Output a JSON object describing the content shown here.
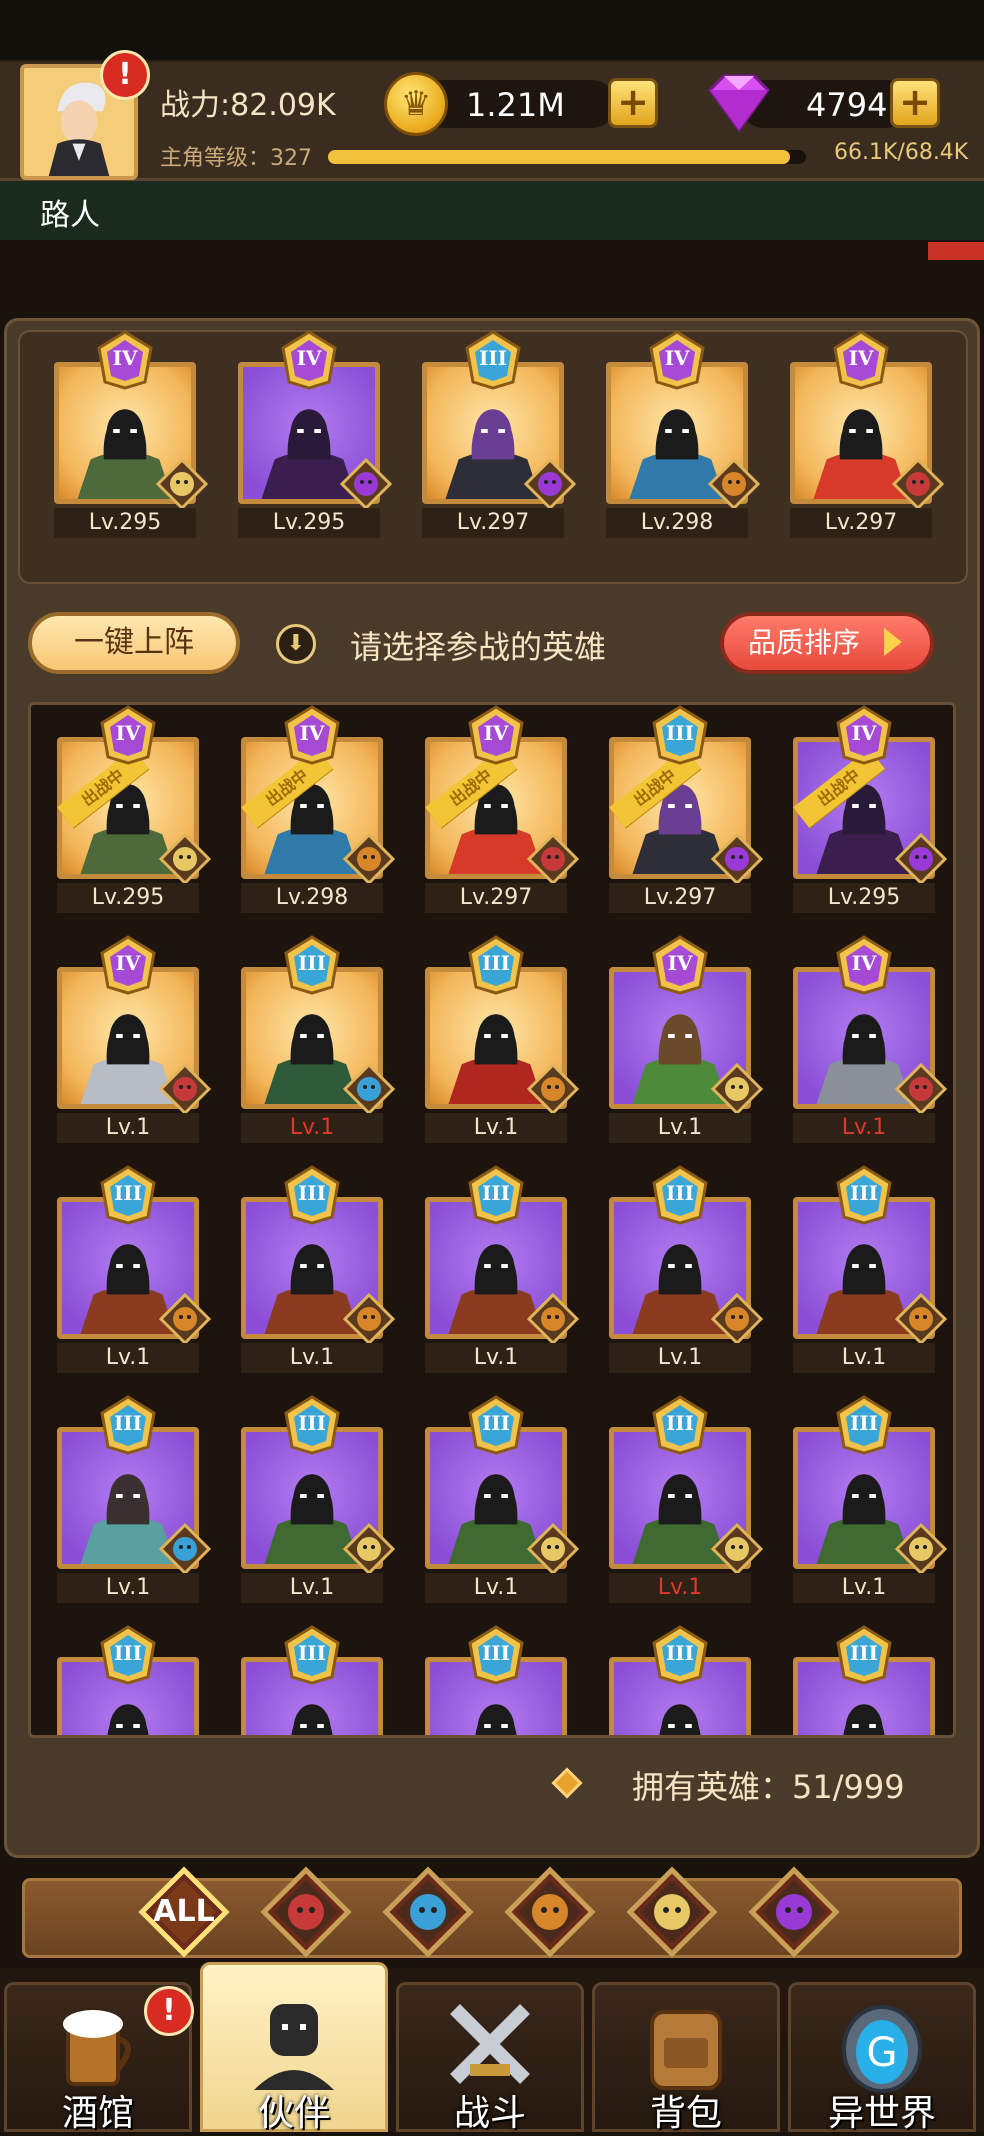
{
  "player": {
    "name": "路人",
    "power": "战力:82.09K",
    "level_label": "主角等级：327",
    "exp": "66.1K/68.4K",
    "exp_fraction": 0.966,
    "alert": "!"
  },
  "resources": {
    "gold": "1.21M",
    "gems": "4794",
    "plus": "+"
  },
  "lineup": [
    {
      "rank": "IV",
      "level": "Lv.295",
      "bg": "gold",
      "faction": "elf",
      "skin": "#1b1b1b",
      "outfit": "#4d6a3a"
    },
    {
      "rank": "IV",
      "level": "Lv.295",
      "bg": "purple",
      "faction": "demon",
      "skin": "#2a1a3a",
      "outfit": "#3a1e4e"
    },
    {
      "rank": "III",
      "level": "Lv.297",
      "bg": "gold",
      "faction": "demon",
      "skin": "#6a3f93",
      "outfit": "#2e2e38"
    },
    {
      "rank": "IV",
      "level": "Lv.298",
      "bg": "gold",
      "faction": "beast",
      "skin": "#1b1b1b",
      "outfit": "#2f7aa8"
    },
    {
      "rank": "IV",
      "level": "Lv.297",
      "bg": "gold",
      "faction": "human",
      "skin": "#1b1b1b",
      "outfit": "#d83a2a"
    }
  ],
  "actions": {
    "deploy": "一键上阵",
    "hint": "请选择参战的英雄",
    "sort": "品质排序",
    "fighting_tag": "出战中",
    "owned": "拥有英雄：51/999"
  },
  "heroes": [
    {
      "rank": "IV",
      "level": "Lv.295",
      "bg": "gold",
      "faction": "elf",
      "fighting": true,
      "red": false,
      "skin": "#1b1b1b",
      "outfit": "#4d6a3a"
    },
    {
      "rank": "IV",
      "level": "Lv.298",
      "bg": "gold",
      "faction": "beast",
      "fighting": true,
      "red": false,
      "skin": "#1b1b1b",
      "outfit": "#2f7aa8"
    },
    {
      "rank": "IV",
      "level": "Lv.297",
      "bg": "gold",
      "faction": "human",
      "fighting": true,
      "red": false,
      "skin": "#1b1b1b",
      "outfit": "#d83a2a"
    },
    {
      "rank": "III",
      "level": "Lv.297",
      "bg": "gold",
      "faction": "demon",
      "fighting": true,
      "red": false,
      "skin": "#6a3f93",
      "outfit": "#2e2e38"
    },
    {
      "rank": "IV",
      "level": "Lv.295",
      "bg": "purple",
      "faction": "demon",
      "fighting": true,
      "red": false,
      "skin": "#2a1a3a",
      "outfit": "#3a1e4e"
    },
    {
      "rank": "IV",
      "level": "Lv.1",
      "bg": "gold",
      "faction": "human",
      "fighting": false,
      "red": false,
      "skin": "#1b1b1b",
      "outfit": "#b8bcc4"
    },
    {
      "rank": "III",
      "level": "Lv.1",
      "bg": "gold",
      "faction": "fish",
      "fighting": false,
      "red": true,
      "skin": "#1b1b1b",
      "outfit": "#2e5a3a"
    },
    {
      "rank": "III",
      "level": "Lv.1",
      "bg": "gold",
      "faction": "beast",
      "fighting": false,
      "red": false,
      "skin": "#1b1b1b",
      "outfit": "#b0271f"
    },
    {
      "rank": "IV",
      "level": "Lv.1",
      "bg": "purple",
      "faction": "elf",
      "fighting": false,
      "red": false,
      "skin": "#6b4a2b",
      "outfit": "#4d8a3a"
    },
    {
      "rank": "IV",
      "level": "Lv.1",
      "bg": "purple",
      "faction": "human",
      "fighting": false,
      "red": true,
      "skin": "#1b1b1b",
      "outfit": "#8a8f99"
    },
    {
      "rank": "III",
      "level": "Lv.1",
      "bg": "purple",
      "faction": "beast",
      "fighting": false,
      "red": false,
      "skin": "#1b1b1b",
      "outfit": "#8a3a1e"
    },
    {
      "rank": "III",
      "level": "Lv.1",
      "bg": "purple",
      "faction": "beast",
      "fighting": false,
      "red": false,
      "skin": "#1b1b1b",
      "outfit": "#8a3a1e"
    },
    {
      "rank": "III",
      "level": "Lv.1",
      "bg": "purple",
      "faction": "beast",
      "fighting": false,
      "red": false,
      "skin": "#1b1b1b",
      "outfit": "#8a3a1e"
    },
    {
      "rank": "III",
      "level": "Lv.1",
      "bg": "purple",
      "faction": "beast",
      "fighting": false,
      "red": false,
      "skin": "#1b1b1b",
      "outfit": "#8a3a1e"
    },
    {
      "rank": "III",
      "level": "Lv.1",
      "bg": "purple",
      "faction": "beast",
      "fighting": false,
      "red": false,
      "skin": "#1b1b1b",
      "outfit": "#8a3a1e"
    },
    {
      "rank": "III",
      "level": "Lv.1",
      "bg": "purple",
      "faction": "fish",
      "fighting": false,
      "red": false,
      "skin": "#3a3030",
      "outfit": "#5aa0a0"
    },
    {
      "rank": "III",
      "level": "Lv.1",
      "bg": "purple",
      "faction": "elf",
      "fighting": false,
      "red": false,
      "skin": "#1b1b1b",
      "outfit": "#3f6a32"
    },
    {
      "rank": "III",
      "level": "Lv.1",
      "bg": "purple",
      "faction": "elf",
      "fighting": false,
      "red": false,
      "skin": "#1b1b1b",
      "outfit": "#3f6a32"
    },
    {
      "rank": "III",
      "level": "Lv.1",
      "bg": "purple",
      "faction": "elf",
      "fighting": false,
      "red": true,
      "skin": "#1b1b1b",
      "outfit": "#3f6a32"
    },
    {
      "rank": "III",
      "level": "Lv.1",
      "bg": "purple",
      "faction": "elf",
      "fighting": false,
      "red": false,
      "skin": "#1b1b1b",
      "outfit": "#3f6a32"
    },
    {
      "rank": "III",
      "level": "",
      "bg": "purple",
      "faction": "elf",
      "fighting": false,
      "red": false,
      "skin": "#1b1b1b",
      "outfit": "#3f6a32"
    },
    {
      "rank": "III",
      "level": "",
      "bg": "purple",
      "faction": "elf",
      "fighting": false,
      "red": false,
      "skin": "#1b1b1b",
      "outfit": "#8fbf6a"
    },
    {
      "rank": "III",
      "level": "",
      "bg": "purple",
      "faction": "elf",
      "fighting": false,
      "red": false,
      "skin": "#1b1b1b",
      "outfit": "#8fbf6a"
    },
    {
      "rank": "III",
      "level": "",
      "bg": "purple",
      "faction": "elf",
      "fighting": false,
      "red": false,
      "skin": "#1b1b1b",
      "outfit": "#8fbf6a"
    },
    {
      "rank": "III",
      "level": "",
      "bg": "purple",
      "faction": "beast",
      "fighting": false,
      "red": false,
      "skin": "#1b1b1b",
      "outfit": "#d8452a"
    }
  ],
  "filters": [
    {
      "key": "all",
      "label": "ALL",
      "selected": true
    },
    {
      "key": "human-crown-icon",
      "label": ""
    },
    {
      "key": "fish-icon",
      "label": ""
    },
    {
      "key": "lion-icon",
      "label": ""
    },
    {
      "key": "elf-icon",
      "label": ""
    },
    {
      "key": "demon-icon",
      "label": ""
    }
  ],
  "nav": [
    {
      "key": "tavern",
      "label": "酒馆",
      "icon": "beer-mug-icon",
      "active": false,
      "alert": "!"
    },
    {
      "key": "partners",
      "label": "伙伴",
      "icon": "partner-icon",
      "active": true
    },
    {
      "key": "battle",
      "label": "战斗",
      "icon": "crossed-swords-icon",
      "active": false
    },
    {
      "key": "bag",
      "label": "背包",
      "icon": "backpack-icon",
      "active": false
    },
    {
      "key": "otherworld",
      "label": "异世界",
      "icon": "portal-icon",
      "active": false
    }
  ],
  "colors": {
    "gold_frame": "#c58b3c",
    "gold_bg": "#f3b65a",
    "purple_bg": "#8a4fd6",
    "alert_red": "#d82b22",
    "level_bar": "#f1c13b"
  }
}
